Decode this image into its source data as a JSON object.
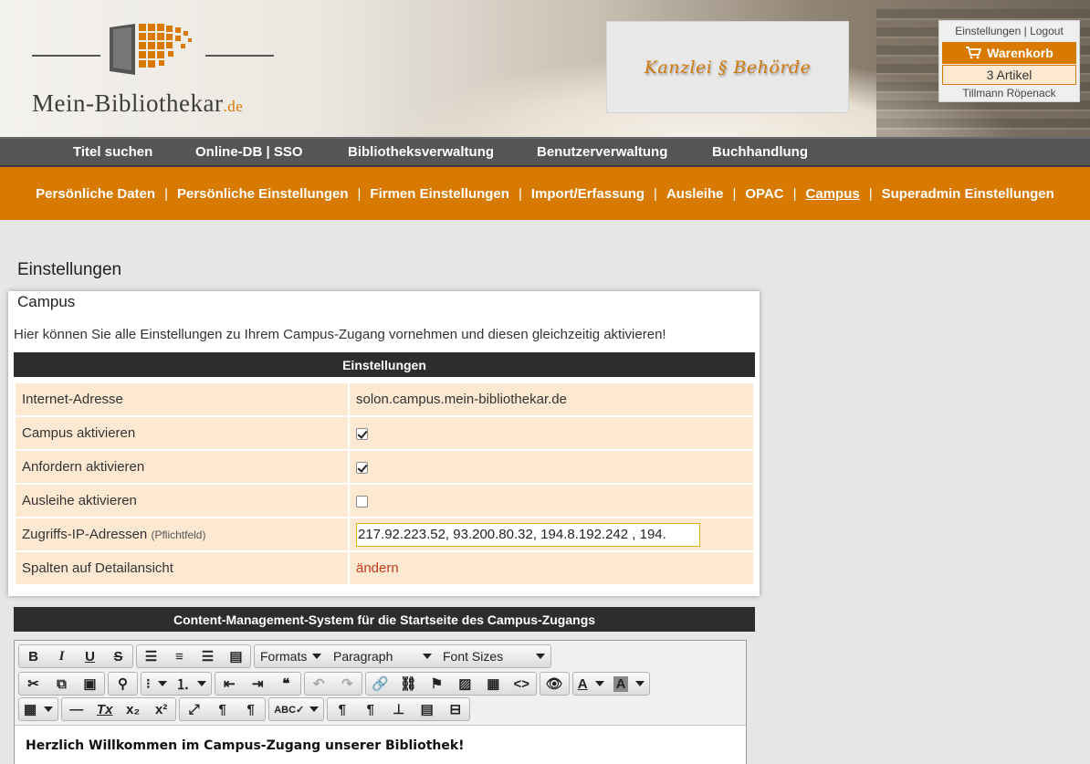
{
  "brand": {
    "logo_main": "Mein-Bibliothekar",
    "logo_suffix": ".de"
  },
  "ad": {
    "text": "Kanzlei § Behörde"
  },
  "user": {
    "settings_link": "Einstellungen",
    "separator": "|",
    "logout_link": "Logout",
    "cart_label": "Warenkorb",
    "cart_count": "3 Artikel",
    "name": "Tillmann Röpenack"
  },
  "main_nav": [
    {
      "label": "Titel suchen"
    },
    {
      "label": "Online-DB | SSO"
    },
    {
      "label": "Bibliotheksverwaltung"
    },
    {
      "label": "Benutzerverwaltung"
    },
    {
      "label": "Buchhandlung"
    }
  ],
  "sub_nav": [
    {
      "label": "Persönliche Daten"
    },
    {
      "label": "Persönliche Einstellungen"
    },
    {
      "label": "Firmen Einstellungen"
    },
    {
      "label": "Import/Erfassung"
    },
    {
      "label": "Ausleihe"
    },
    {
      "label": "OPAC"
    },
    {
      "label": "Campus",
      "active": true
    },
    {
      "label": "Superadmin Einstellungen"
    }
  ],
  "page": {
    "title": "Einstellungen",
    "panel_title": "Campus",
    "description": "Hier können Sie alle Einstellungen zu Ihrem Campus-Zugang vornehmen und diesen gleichzeitig aktivieren!",
    "settings_header": "Einstellungen",
    "rows": {
      "internet_address": {
        "label": "Internet-Adresse",
        "value": "solon.campus.mein-bibliothekar.de"
      },
      "campus_active": {
        "label": "Campus aktivieren",
        "checked": true
      },
      "request_active": {
        "label": "Anfordern aktivieren",
        "checked": true
      },
      "lending_active": {
        "label": "Ausleihe aktivieren",
        "checked": false
      },
      "ip_addresses": {
        "label": "Zugriffs-IP-Adressen",
        "hint": "(Pflichtfeld)",
        "value": "217.92.223.52, 93.200.80.32, 194.8.192.242 , 194."
      },
      "detail_columns": {
        "label": "Spalten auf Detailansicht",
        "link": "ändern"
      }
    },
    "cms_header": "Content-Management-System für die Startseite des Campus-Zugangs"
  },
  "editor": {
    "dropdowns": {
      "formats": "Formats",
      "paragraph": "Paragraph",
      "font_sizes": "Font Sizes"
    },
    "content": "Herzlich Willkommen im Campus-Zugang unserer Bibliothek!"
  },
  "colors": {
    "accent": "#d97a00",
    "nav_bg": "#555555",
    "row_bg": "#fde9d2",
    "bar_bg": "#2d2d2d"
  }
}
